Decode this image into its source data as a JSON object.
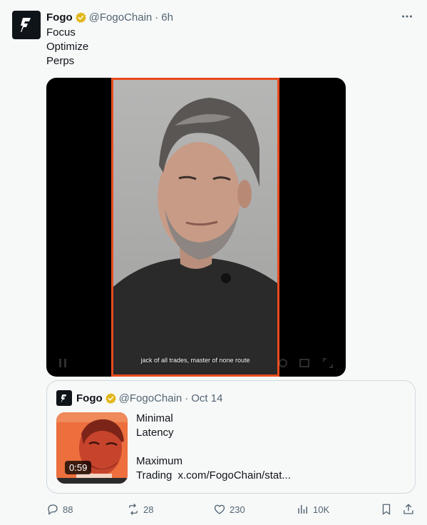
{
  "tweet": {
    "display_name": "Fogo",
    "handle": "@FogoChain",
    "separator": "·",
    "time": "6h",
    "lines": [
      "Focus",
      "Optimize",
      "Perps"
    ]
  },
  "video": {
    "subtitle": "jack of all trades, master of none route"
  },
  "quote": {
    "display_name": "Fogo",
    "handle": "@FogoChain",
    "separator": "·",
    "date": "Oct 14",
    "duration": "0:59",
    "lines": [
      "Minimal",
      "Latency",
      "",
      "Maximum"
    ],
    "last_line_prefix": "Trading",
    "link": "x.com/FogoChain/stat..."
  },
  "actions": {
    "replies": "88",
    "reposts": "28",
    "likes": "230",
    "views": "10K"
  },
  "colors": {
    "accent_orange": "#ea4a1d",
    "verified_gold": "#e2b719",
    "muted": "#536471"
  },
  "icons": [
    "fogo-logo-icon",
    "verified-badge-icon",
    "more-icon",
    "reply-icon",
    "repost-icon",
    "like-icon",
    "views-icon",
    "bookmark-icon",
    "share-icon"
  ]
}
